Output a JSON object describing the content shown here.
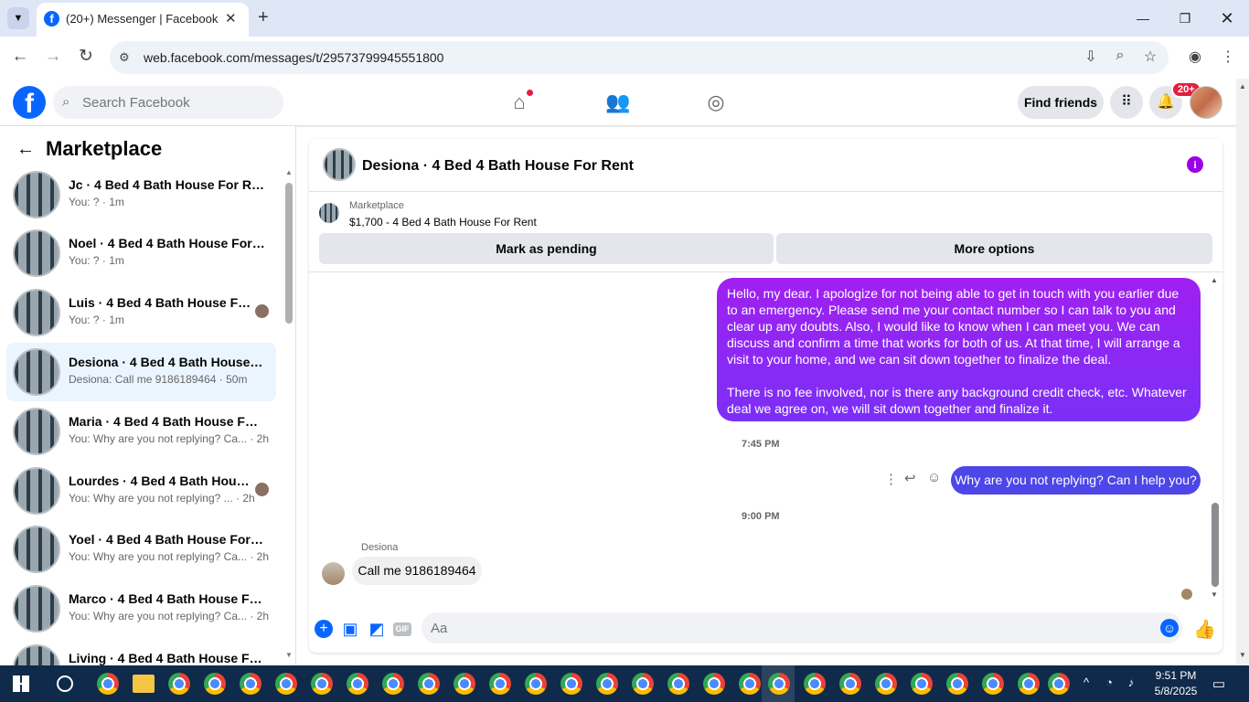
{
  "browser": {
    "tab_title": "(20+) Messenger | Facebook",
    "url": "web.facebook.com/messages/t/29573799945551800"
  },
  "fb_header": {
    "search_placeholder": "Search Facebook",
    "find_friends": "Find friends",
    "notification_badge": "20+"
  },
  "sidebar": {
    "title": "Marketplace",
    "conversations": [
      {
        "name": "Jc · 4 Bed 4 Bath House For Rent",
        "preview": "You: ? · 1m",
        "active": false
      },
      {
        "name": "Noel · 4 Bed 4 Bath House For R...",
        "preview": "You: ? · 1m",
        "active": false
      },
      {
        "name": "Luis · 4 Bed 4 Bath House For ...",
        "preview": "You: ? · 1m",
        "active": false
      },
      {
        "name": "Desiona · 4 Bed 4 Bath House F...",
        "preview": "Desiona: Call me 9186189464 · 50m",
        "active": true
      },
      {
        "name": "Maria · 4 Bed 4 Bath House For ...",
        "preview": "You: Why are you not replying? Ca... · 2h",
        "active": false
      },
      {
        "name": "Lourdes · 4 Bed 4 Bath House...",
        "preview": "You: Why are you not replying? ... · 2h",
        "active": false
      },
      {
        "name": "Yoel · 4 Bed 4 Bath House For R...",
        "preview": "You: Why are you not replying? Ca... · 2h",
        "active": false
      },
      {
        "name": "Marco · 4 Bed 4 Bath House For...",
        "preview": "You: Why are you not replying? Ca... · 2h",
        "active": false
      },
      {
        "name": "Living · 4 Bed 4 Bath House For ...",
        "preview": "",
        "active": false
      }
    ]
  },
  "chat": {
    "title": "Desiona · 4 Bed 4 Bath House For Rent",
    "listing_label": "Marketplace",
    "listing_price": "$1,700 - 4 Bed 4 Bath House For Rent",
    "mark_pending": "Mark as pending",
    "more_options": "More options",
    "msg1_p1": "Hello, my dear. I apologize for not being able to get in touch with you earlier due to an emergency. Please send me your contact number so I can talk to you and clear up any doubts. Also, I would like to know when I can meet you. We can discuss and confirm a time that works for both of us. At that time, I will arrange a visit to your home, and we can sit down together to finalize the deal.",
    "msg1_p2": "There is no fee involved, nor is there any background credit check, etc. Whatever deal we agree on, we will sit down together and finalize it.",
    "time1": "7:45 PM",
    "msg2": "Why are you not replying? Can I help you?",
    "time2": "9:00 PM",
    "sender_name": "Desiona",
    "msg3": "Call me 9186189464",
    "composer_placeholder": "Aa"
  },
  "taskbar": {
    "time": "9:51 PM",
    "date": "5/8/2025"
  }
}
